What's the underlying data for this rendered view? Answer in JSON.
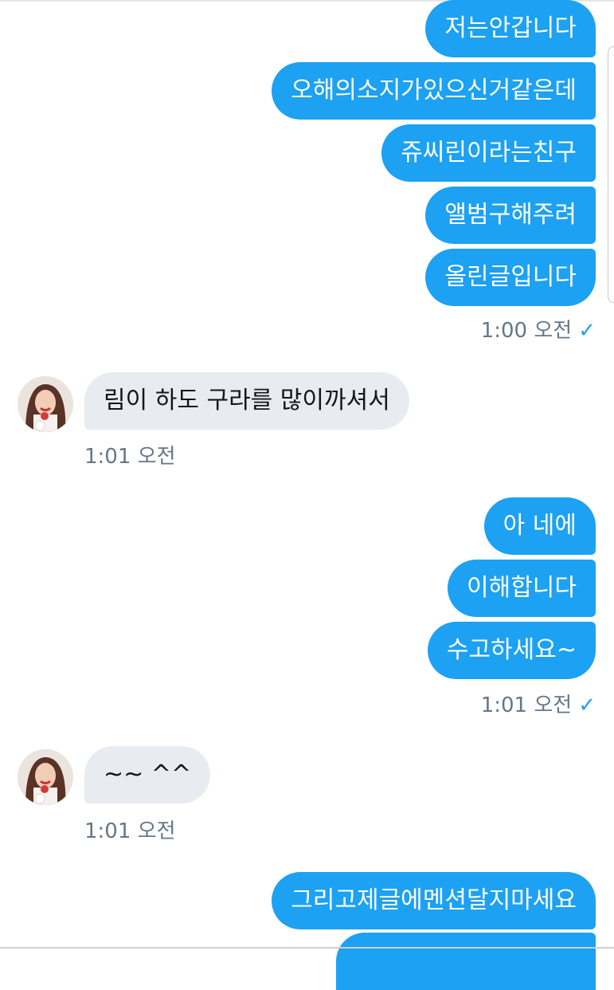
{
  "outgoing_group_1": {
    "messages": [
      "저는안갑니다",
      "오해의소지가있으신거같은데",
      "쥬씨린이라는친구",
      "앨범구해주려",
      "올린글입니다"
    ],
    "time": "1:00 오전"
  },
  "incoming_1": {
    "message": "림이 하도 구라를 많이까셔서",
    "time": "1:01 오전"
  },
  "outgoing_group_2": {
    "messages": [
      "아 네에",
      "이해합니다",
      "수고하세요~"
    ],
    "time": "1:01 오전"
  },
  "incoming_2": {
    "message": "~~ ^^",
    "time": "1:01 오전"
  },
  "outgoing_group_3": {
    "messages": [
      "그리고제글에멘션달지마세요"
    ]
  },
  "icons": {
    "read_receipt": "checkmark-icon",
    "avatar": "user-avatar"
  },
  "colors": {
    "outgoing_bubble": "#1da1f2",
    "incoming_bubble": "#e8ecf0",
    "timestamp": "#657786"
  }
}
